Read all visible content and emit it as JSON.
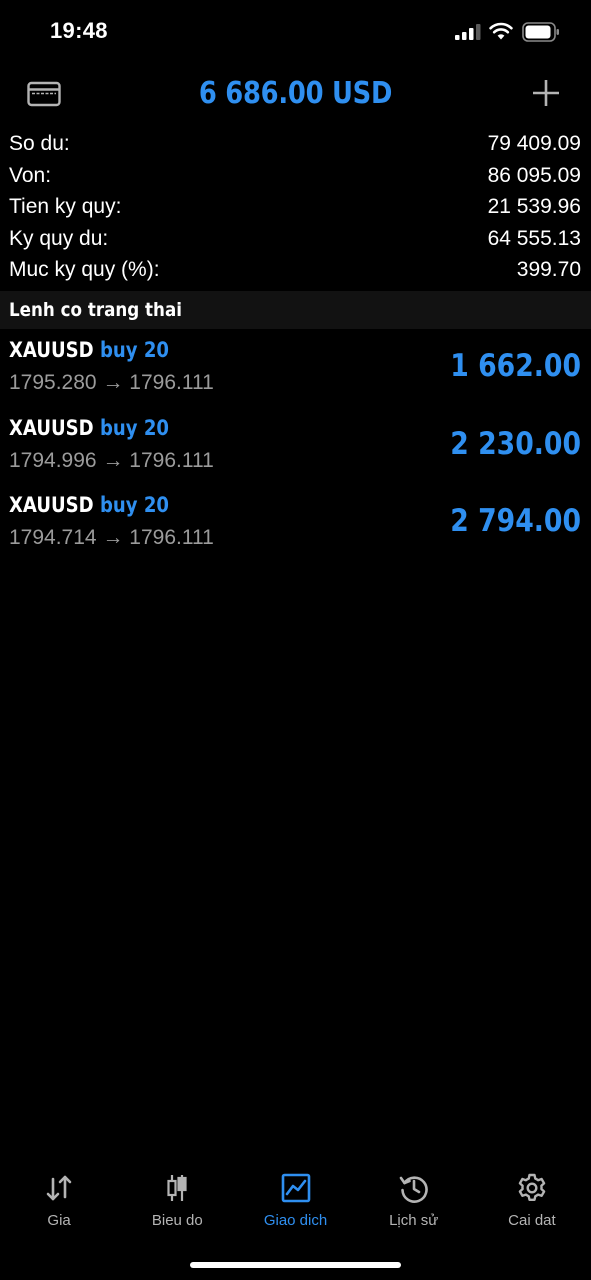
{
  "status_bar": {
    "time": "19:48"
  },
  "header": {
    "title": "6 686.00 USD",
    "left_icon": "credit-card-icon",
    "right_icon": "plus-icon"
  },
  "account": [
    {
      "label": "So du:",
      "value": "79 409.09"
    },
    {
      "label": "Von:",
      "value": "86 095.09"
    },
    {
      "label": "Tien ky quy:",
      "value": "21 539.96"
    },
    {
      "label": "Ky quy du:",
      "value": "64 555.13"
    },
    {
      "label": "Muc ky quy (%):",
      "value": "399.70"
    }
  ],
  "positions_section": {
    "title": "Lenh co trang thai"
  },
  "positions": [
    {
      "symbol": "XAUUSD",
      "type": "buy 20",
      "open_price": "1795.280",
      "arrow": "→",
      "current_price": "1796.111",
      "profit": "1 662.00"
    },
    {
      "symbol": "XAUUSD",
      "type": "buy 20",
      "open_price": "1794.996",
      "arrow": "→",
      "current_price": "1796.111",
      "profit": "2 230.00"
    },
    {
      "symbol": "XAUUSD",
      "type": "buy 20",
      "open_price": "1794.714",
      "arrow": "→",
      "current_price": "1796.111",
      "profit": "2 794.00"
    }
  ],
  "tabs": [
    {
      "label": "Gia",
      "icon": "arrows-updown-icon",
      "active": false
    },
    {
      "label": "Bieu do",
      "icon": "candlestick-icon",
      "active": false
    },
    {
      "label": "Giao dich",
      "icon": "trade-chart-icon",
      "active": true
    },
    {
      "label": "Lịch sử",
      "icon": "history-clock-icon",
      "active": false
    },
    {
      "label": "Cai dat",
      "icon": "gear-icon",
      "active": false
    }
  ],
  "colors": {
    "accent": "#2f8ff0",
    "background": "#000000",
    "text": "#ffffff",
    "muted_text": "#9b9b9b",
    "section_bg": "#121212"
  }
}
